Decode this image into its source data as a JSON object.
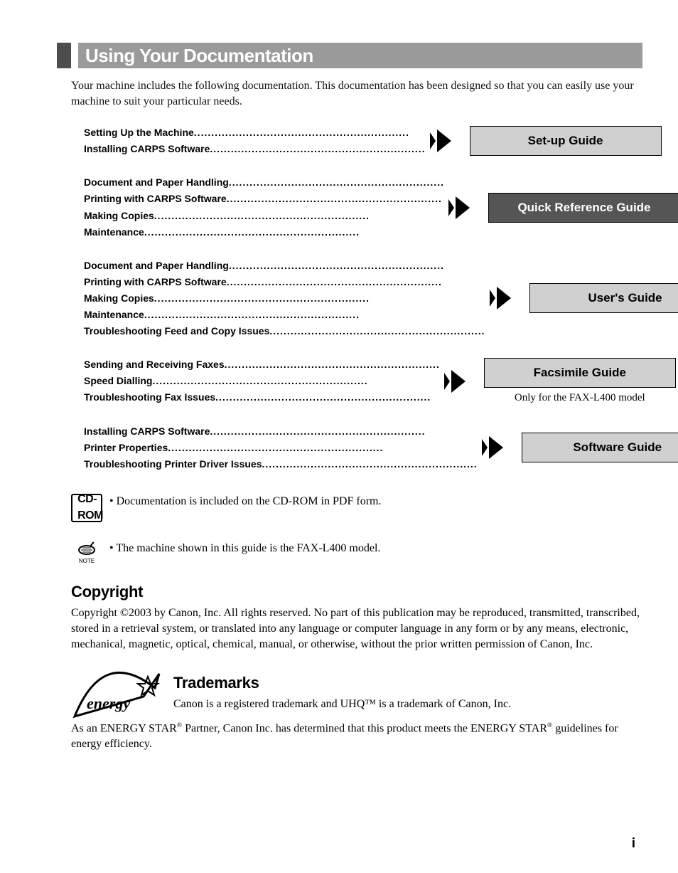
{
  "heading": "Using Your Documentation",
  "intro": "Your machine includes the following documentation. This documentation has been designed so that you can easily use your machine to suit your particular needs.",
  "guides": [
    {
      "topics": [
        "Setting Up the Machine",
        "Installing CARPS Software"
      ],
      "name": "Set-up Guide",
      "dark": false,
      "cd": false,
      "caption": ""
    },
    {
      "topics": [
        "Document and Paper Handling",
        "Printing with CARPS Software",
        "Making Copies",
        "Maintenance"
      ],
      "name": "Quick Reference Guide",
      "dark": true,
      "cd": false,
      "caption": ""
    },
    {
      "topics": [
        "Document and Paper Handling",
        "Printing with CARPS Software",
        "Making Copies",
        "Maintenance",
        "Troubleshooting Feed and Copy Issues"
      ],
      "name": "User's Guide",
      "dark": false,
      "cd": true,
      "caption": ""
    },
    {
      "topics": [
        "Sending and Receiving Faxes",
        "Speed Dialling",
        "Troubleshooting Fax Issues"
      ],
      "name": "Facsimile Guide",
      "dark": false,
      "cd": false,
      "caption": "Only for the FAX-L400 model"
    },
    {
      "topics": [
        "Installing CARPS Software",
        "Printer Properties",
        "Troubleshooting Printer Driver Issues"
      ],
      "name": "Software Guide",
      "dark": false,
      "cd": true,
      "caption": ""
    }
  ],
  "notes": {
    "cd_note": "Documentation is included on the CD-ROM in PDF form.",
    "model_note": "The machine shown in this guide is the FAX-L400 model.",
    "note_label": "NOTE",
    "cd_label": "CD-ROM"
  },
  "copyright": {
    "heading": "Copyright",
    "body": "Copyright ©2003 by Canon, Inc. All rights reserved. No part of this publication may be reproduced, transmitted, transcribed, stored in a retrieval system, or translated into any language or computer language in any form or by any means, electronic, mechanical, magnetic, optical, chemical, manual, or otherwise, without the prior written permission of Canon, Inc."
  },
  "trademarks": {
    "heading": "Trademarks",
    "line1": "Canon is a registered trademark and UHQ™ is a trademark of Canon, Inc.",
    "line2_a": "As an ENERGY STAR",
    "line2_b": " Partner, Canon Inc. has determined that this product meets the ENERGY STAR",
    "line2_c": " guidelines for energy efficiency."
  },
  "page_number": "i",
  "dots": ".............................................................."
}
